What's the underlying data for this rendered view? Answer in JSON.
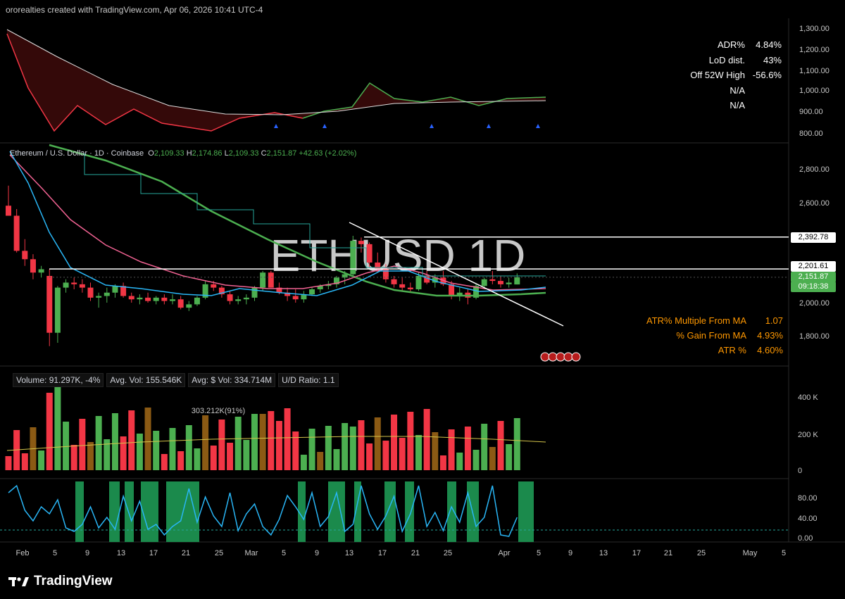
{
  "header": {
    "text": "ororealties created with TradingView.com, Apr 06, 2026 10:41 UTC-4"
  },
  "colors": {
    "bg": "#000000",
    "up": "#4caf50",
    "down": "#f23645",
    "orange": "#ff9800",
    "blue": "#29b6f6"
  },
  "rs_panel": {
    "y_ticks": [
      "1,300.00",
      "1,200.00",
      "1,100.00",
      "1,000.00",
      "900.00",
      "800.00"
    ],
    "stats": [
      {
        "label": "ADR%",
        "value": "4.84%"
      },
      {
        "label": "LoD dist.",
        "value": "43%"
      },
      {
        "label": "Off 52W High",
        "value": "-56.6%"
      },
      {
        "label": "N/A",
        "value": ""
      },
      {
        "label": "N/A",
        "value": ""
      }
    ]
  },
  "price_panel": {
    "symbol": "Ethereum / U.S. Dollar · 1D · Coinbase",
    "ohlc": {
      "o_label": "O",
      "o": "2,109.33",
      "h_label": "H",
      "h": "2,174.86",
      "l_label": "L",
      "l": "2,109.33",
      "c_label": "C",
      "c": "2,151.87",
      "change": "+42.63 (+2.02%)"
    },
    "watermark": "ETHUSD 1D",
    "y_ticks": [
      "2,800.00",
      "2,600.00",
      "2,400.00",
      "2,200.00",
      "2,000.00",
      "1,800.00"
    ],
    "tags": {
      "resistance1": "2,392.78",
      "resistance2": "2,201.61",
      "last_price": "2,151.87",
      "countdown": "09:18:38"
    },
    "atr_stats": [
      {
        "label": "ATR% Multiple From MA",
        "value": "1.07"
      },
      {
        "label": "% Gain From MA",
        "value": "4.93%"
      },
      {
        "label": "ATR %",
        "value": "4.60%"
      }
    ]
  },
  "volume_panel": {
    "legend": [
      "Volume: 91.297K, -4%",
      "Avg. Vol: 155.546K",
      "Avg: $ Vol: 334.714M",
      "U/D Ratio: 1.1"
    ],
    "annotation": "303.212K(91%)",
    "y_ticks": [
      "400 K",
      "200 K",
      "0"
    ]
  },
  "osc_panel": {
    "y_ticks": [
      "80.00",
      "40.00",
      "0.00"
    ]
  },
  "x_axis": [
    "Feb",
    "5",
    "9",
    "13",
    "17",
    "21",
    "25",
    "Mar",
    "5",
    "9",
    "13",
    "17",
    "21",
    "25",
    "Apr",
    "5",
    "9",
    "13",
    "17",
    "21",
    "25",
    "May",
    "5"
  ],
  "footer": {
    "brand": "TradingView"
  },
  "chart_data": {
    "type": "candlestick",
    "symbol": "ETHUSD",
    "interval": "1D",
    "x_start": "Jan 30",
    "candles": [
      [
        2580,
        2700,
        2520,
        2520
      ],
      [
        2520,
        2560,
        2300,
        2310
      ],
      [
        2310,
        2380,
        2220,
        2260
      ],
      [
        2260,
        2290,
        2140,
        2180
      ],
      [
        2180,
        2220,
        2150,
        2200
      ],
      [
        2160,
        2200,
        1740,
        1820
      ],
      [
        1820,
        2100,
        1760,
        2090
      ],
      [
        2090,
        2140,
        2060,
        2120
      ],
      [
        2120,
        2150,
        2080,
        2110
      ],
      [
        2110,
        2140,
        2060,
        2090
      ],
      [
        2090,
        2120,
        2010,
        2030
      ],
      [
        2030,
        2060,
        1970,
        2040
      ],
      [
        2040,
        2090,
        2000,
        2060
      ],
      [
        2060,
        2110,
        2030,
        2100
      ],
      [
        2100,
        2120,
        2030,
        2040
      ],
      [
        2040,
        2060,
        2000,
        2020
      ],
      [
        2020,
        2050,
        1990,
        2030
      ],
      [
        2030,
        2060,
        2000,
        2010
      ],
      [
        2010,
        2040,
        1990,
        2030
      ],
      [
        2030,
        2050,
        1990,
        2010
      ],
      [
        2010,
        2050,
        1990,
        2020
      ],
      [
        2020,
        2040,
        1960,
        1970
      ],
      [
        1970,
        2010,
        1950,
        1990
      ],
      [
        1990,
        2040,
        1980,
        2030
      ],
      [
        2030,
        2130,
        2020,
        2110
      ],
      [
        2110,
        2130,
        2070,
        2090
      ],
      [
        2090,
        2100,
        2030,
        2050
      ],
      [
        2050,
        2070,
        1990,
        2010
      ],
      [
        2010,
        2040,
        1990,
        2020
      ],
      [
        2020,
        2050,
        1990,
        2030
      ],
      [
        2030,
        2100,
        2010,
        2090
      ],
      [
        2090,
        2190,
        2070,
        2180
      ],
      [
        2180,
        2190,
        2090,
        2090
      ],
      [
        2090,
        2120,
        2050,
        2060
      ],
      [
        2060,
        2090,
        2010,
        2040
      ],
      [
        2040,
        2080,
        2000,
        2020
      ],
      [
        2020,
        2070,
        2000,
        2050
      ],
      [
        2050,
        2090,
        2040,
        2080
      ],
      [
        2080,
        2110,
        2060,
        2100
      ],
      [
        2100,
        2130,
        2080,
        2110
      ],
      [
        2110,
        2160,
        2090,
        2150
      ],
      [
        2150,
        2190,
        2110,
        2170
      ],
      [
        2170,
        2400,
        2150,
        2370
      ],
      [
        2370,
        2390,
        2300,
        2350
      ],
      [
        2350,
        2360,
        2210,
        2240
      ],
      [
        2240,
        2300,
        2180,
        2200
      ],
      [
        2200,
        2230,
        2120,
        2140
      ],
      [
        2140,
        2160,
        2090,
        2110
      ],
      [
        2110,
        2150,
        2070,
        2090
      ],
      [
        2090,
        2120,
        2060,
        2080
      ],
      [
        2080,
        2180,
        2070,
        2160
      ],
      [
        2160,
        2190,
        2110,
        2120
      ],
      [
        2120,
        2170,
        2090,
        2150
      ],
      [
        2150,
        2190,
        2100,
        2110
      ],
      [
        2110,
        2130,
        2020,
        2040
      ],
      [
        2040,
        2090,
        2010,
        2060
      ],
      [
        2060,
        2080,
        1990,
        2030
      ],
      [
        2030,
        2110,
        2020,
        2100
      ],
      [
        2100,
        2150,
        2080,
        2140
      ],
      [
        2140,
        2190,
        2110,
        2130
      ],
      [
        2130,
        2160,
        2090,
        2110
      ],
      [
        2110,
        2150,
        2090,
        2120
      ],
      [
        2109,
        2175,
        2109,
        2152
      ]
    ],
    "levels": [
      2392.78,
      2201.61
    ],
    "last_price": 2151.87
  }
}
